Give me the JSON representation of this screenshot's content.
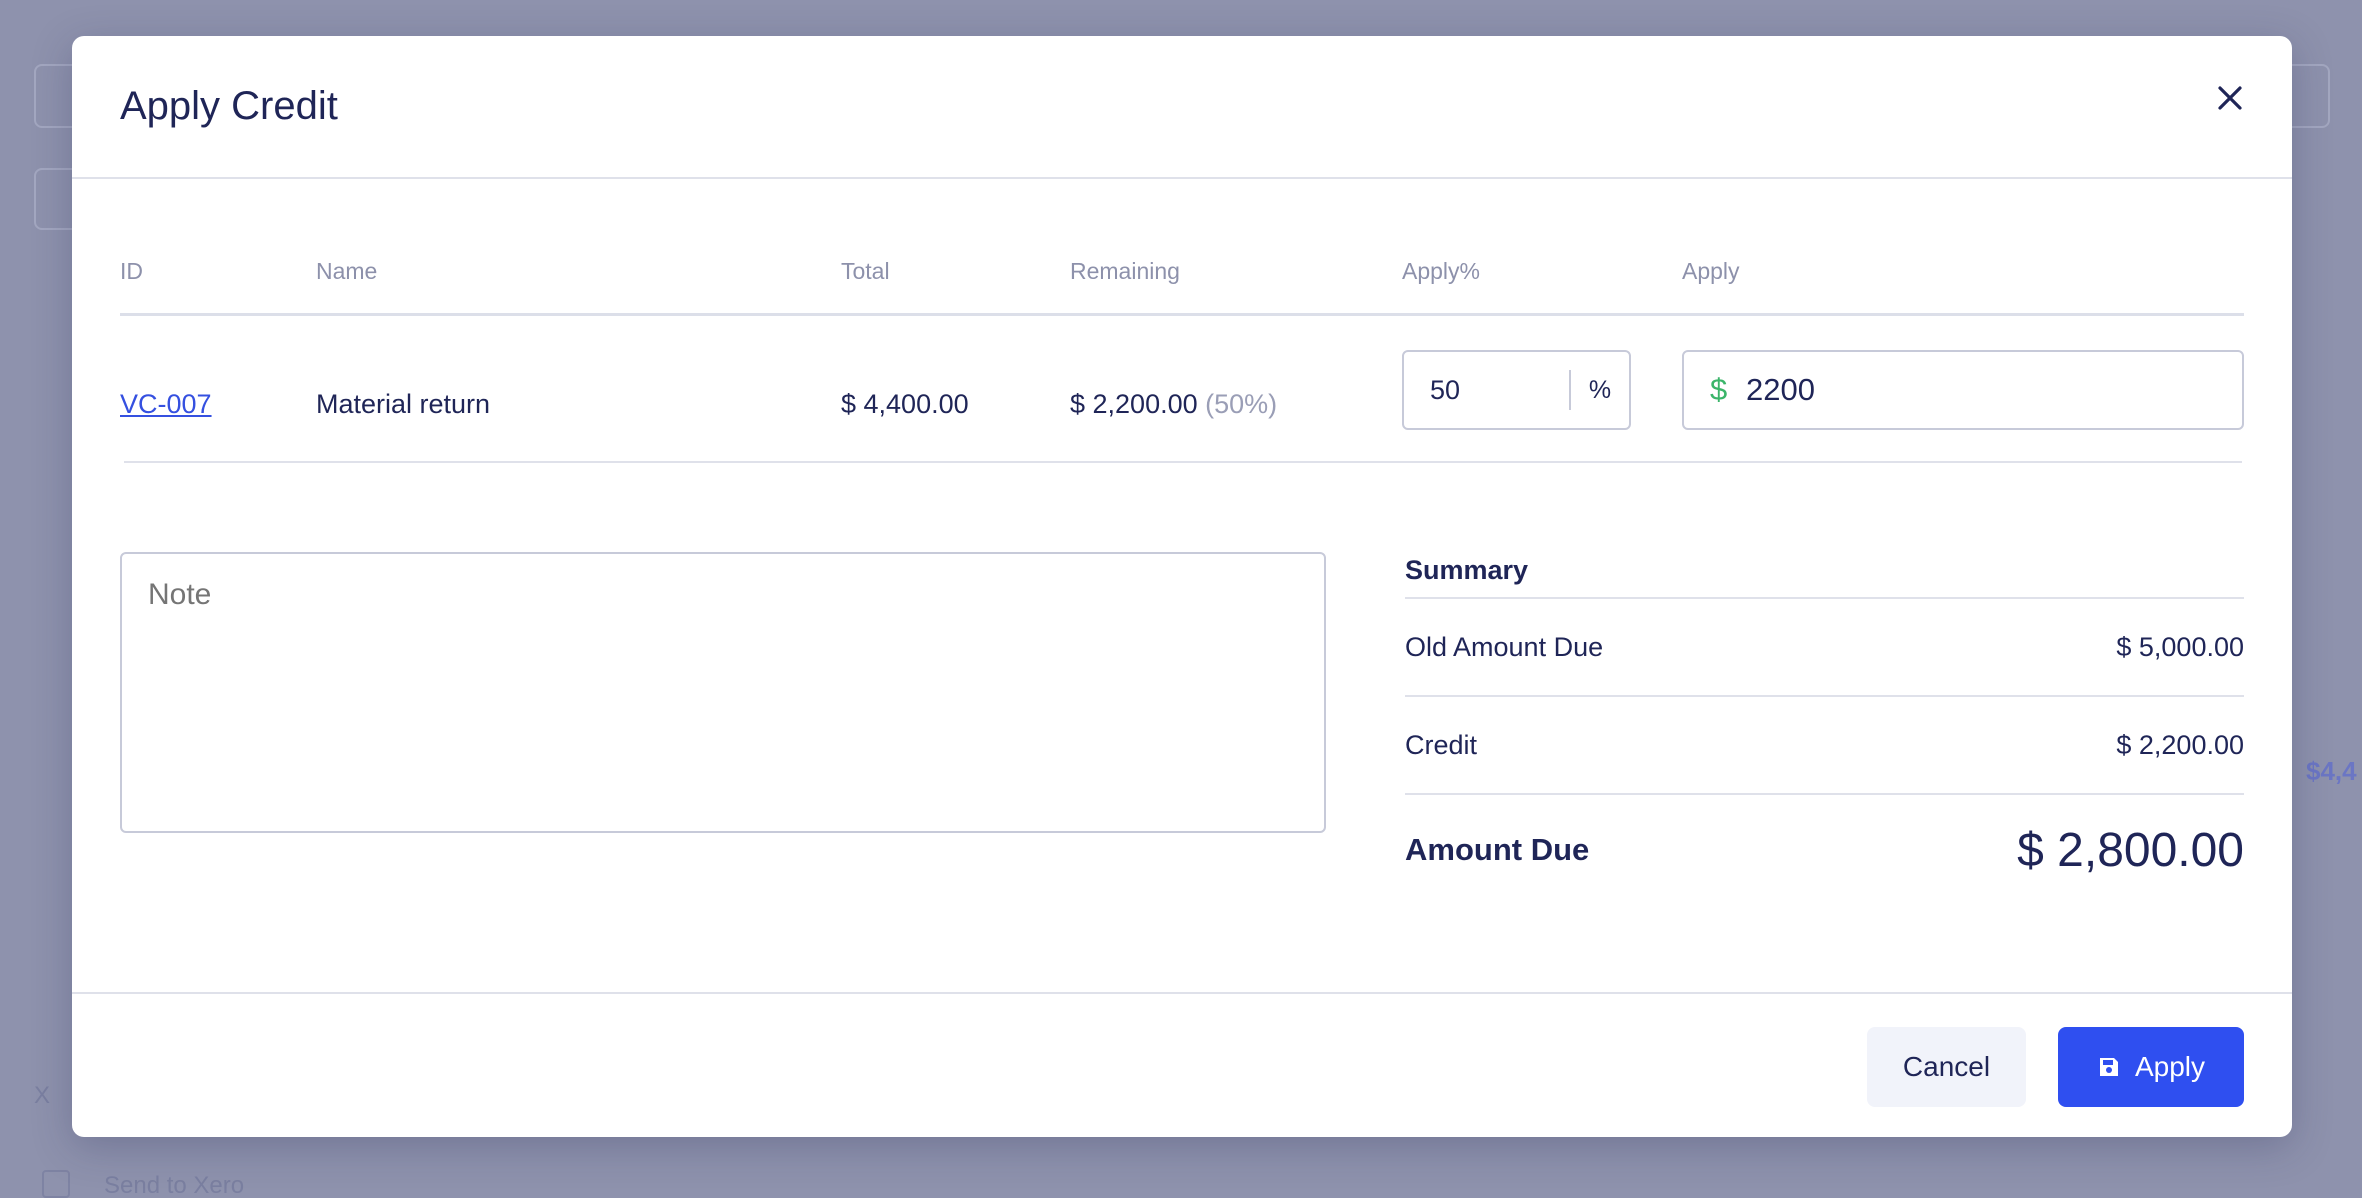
{
  "dialog": {
    "title": "Apply Credit"
  },
  "table": {
    "headers": {
      "id": "ID",
      "name": "Name",
      "total": "Total",
      "remaining": "Remaining",
      "apply_percent": "Apply%",
      "apply": "Apply"
    },
    "row": {
      "id": "VC-007",
      "name": "Material return",
      "total": "$ 4,400.00",
      "remaining": "$ 2,200.00",
      "remaining_percent": "(50%)",
      "apply_percent_value": "50",
      "percent_suffix": "%",
      "currency_prefix": "$",
      "apply_value": "2200"
    }
  },
  "note": {
    "placeholder": "Note"
  },
  "summary": {
    "title": "Summary",
    "old_amount_due_label": "Old Amount Due",
    "old_amount_due_value": "$ 5,000.00",
    "credit_label": "Credit",
    "credit_value": "$ 2,200.00",
    "amount_due_label": "Amount Due",
    "amount_due_value": "$ 2,800.00"
  },
  "footer": {
    "cancel_label": "Cancel",
    "apply_label": "Apply"
  },
  "background": {
    "send_to_xero": "Send to Xero",
    "amount_fragment": "$4,4",
    "section_fragment": "X"
  },
  "colors": {
    "primary": "#2f4ff0",
    "link": "#3550e0",
    "currency_green": "#3bb56a",
    "text_dark": "#1f2557",
    "overlay": "#8e92ad"
  }
}
